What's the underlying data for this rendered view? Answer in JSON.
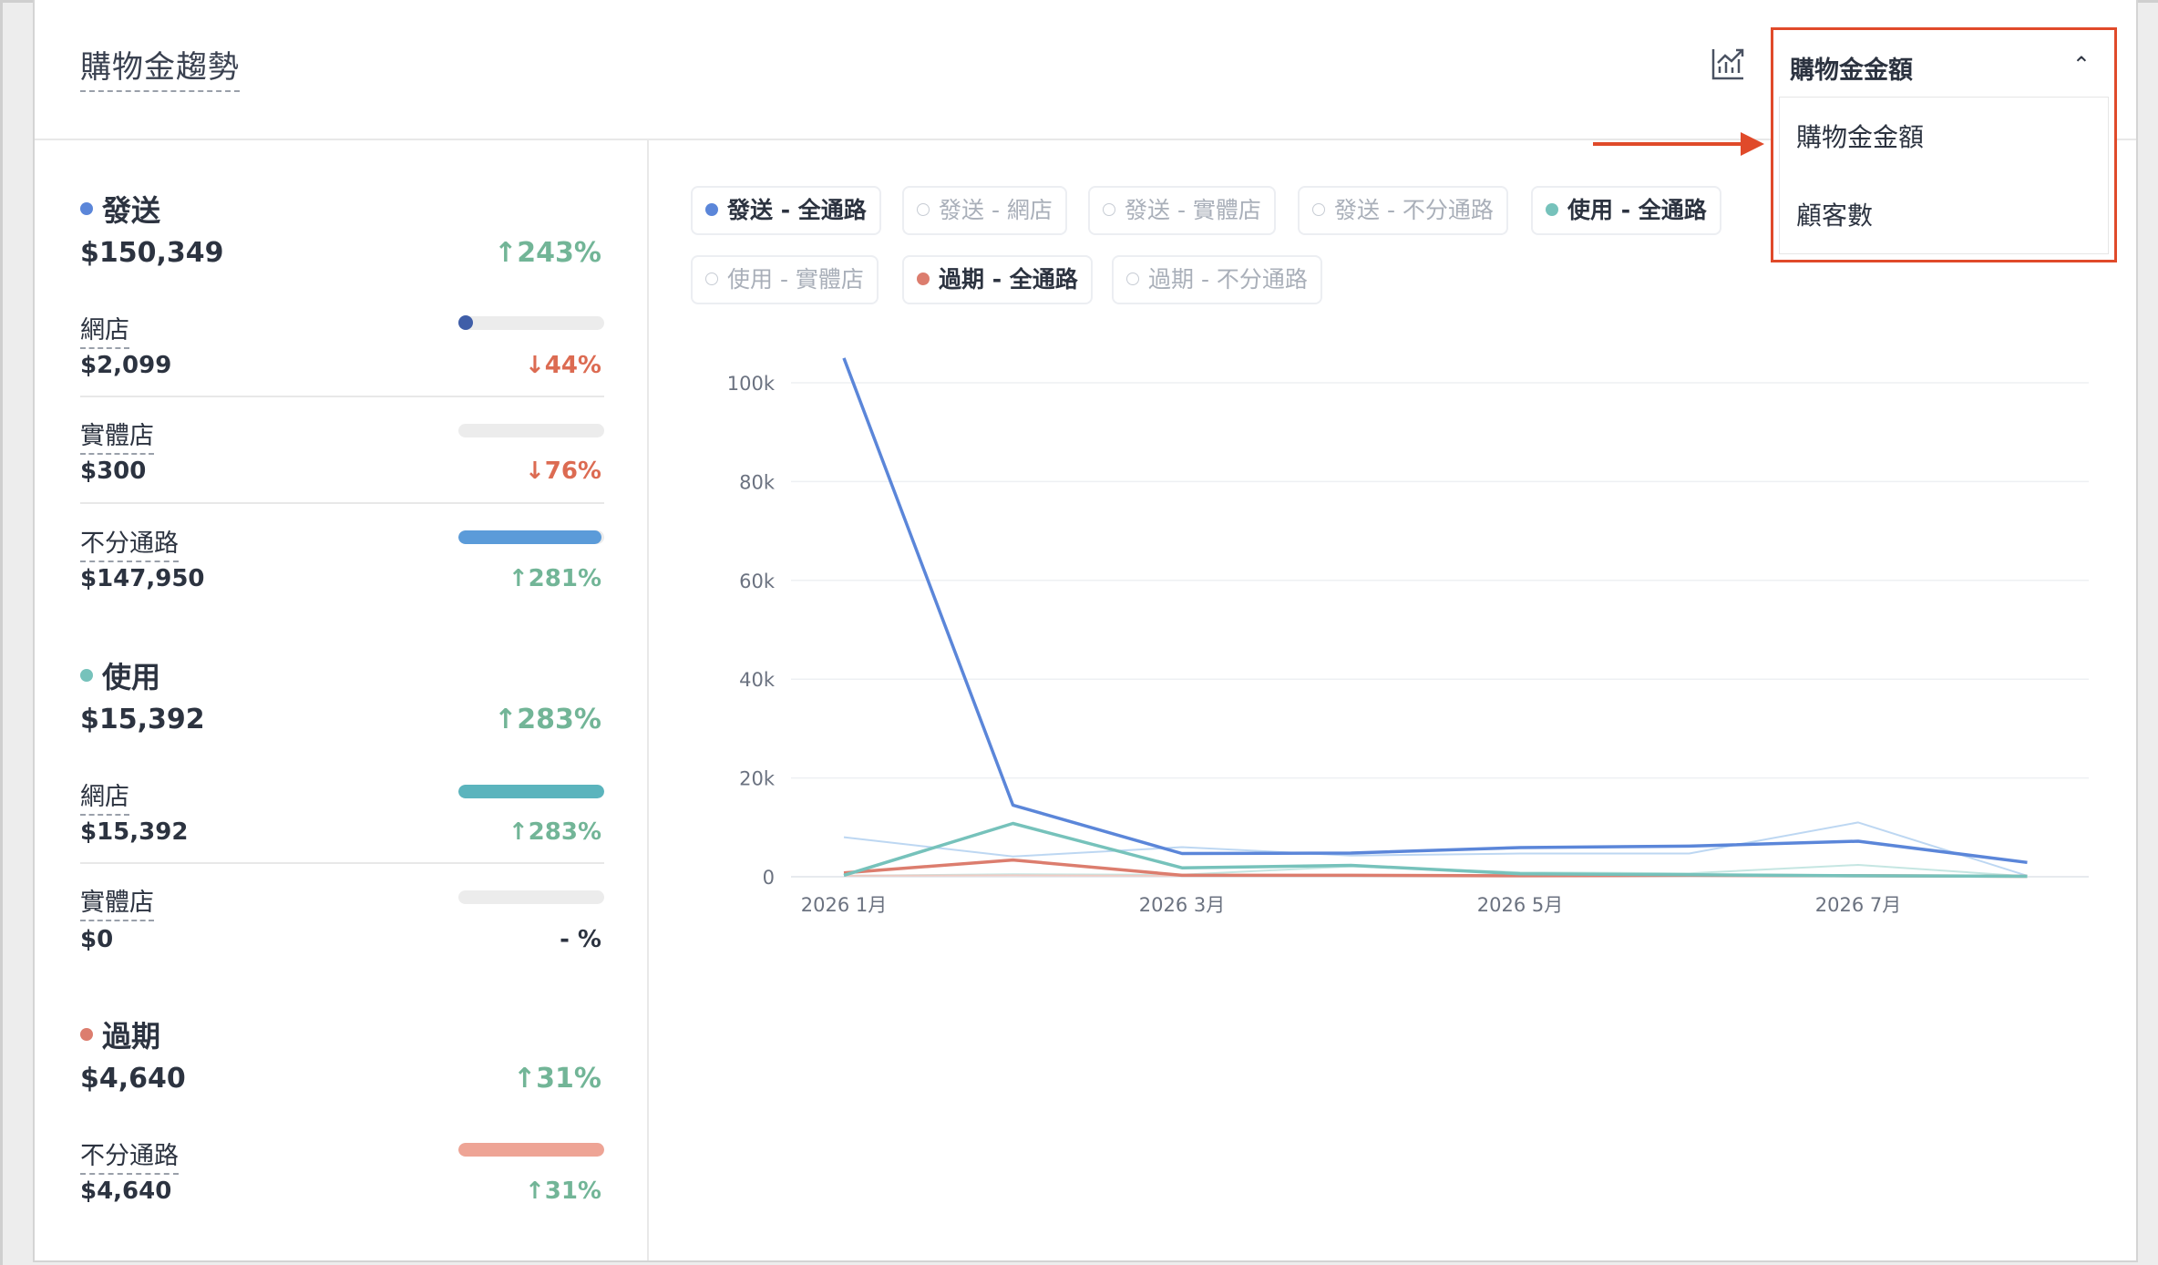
{
  "header": {
    "title": "購物金趨勢",
    "metric_select": {
      "selected": "購物金金額",
      "options": [
        "購物金金額",
        "顧客數"
      ]
    }
  },
  "colors": {
    "issue": "#5b86d9",
    "use": "#76c2bb",
    "expire": "#dc7d6e",
    "up": "#72b597",
    "down": "#dc6b52",
    "highlight": "#e04a2a"
  },
  "summary": {
    "groups": [
      {
        "name": "發送",
        "total": "$150,349",
        "change": "↑243%",
        "trend": "up",
        "color": "#5b86d9",
        "channels": [
          {
            "name": "網店",
            "value": "$2,099",
            "change": "↓44%",
            "trend": "down",
            "share": 0.014,
            "color": "#3f5ea8"
          },
          {
            "name": "實體店",
            "value": "$300",
            "change": "↓76%",
            "trend": "down",
            "share": 0.002,
            "color": "#5b86d9"
          },
          {
            "name": "不分通路",
            "value": "$147,950",
            "change": "↑281%",
            "trend": "up",
            "share": 0.984,
            "color": "#5b9bd9"
          }
        ]
      },
      {
        "name": "使用",
        "total": "$15,392",
        "change": "↑283%",
        "trend": "up",
        "color": "#76c2bb",
        "channels": [
          {
            "name": "網店",
            "value": "$15,392",
            "change": "↑283%",
            "trend": "up",
            "share": 1.0,
            "color": "#5bb4bd"
          },
          {
            "name": "實體店",
            "value": "$0",
            "change": "- %",
            "trend": "neutral",
            "share": 0,
            "color": "#5bb4bd"
          }
        ]
      },
      {
        "name": "過期",
        "total": "$4,640",
        "change": "↑31%",
        "trend": "up",
        "color": "#dc7d6e",
        "channels": [
          {
            "name": "不分通路",
            "value": "$4,640",
            "change": "↑31%",
            "trend": "up",
            "share": 1.0,
            "color": "#eea495"
          }
        ]
      }
    ]
  },
  "legend": [
    {
      "label": "發送 - 全通路",
      "active": true,
      "color": "#5b86d9"
    },
    {
      "label": "發送 - 網店",
      "active": false,
      "color": "#c7ccd4"
    },
    {
      "label": "發送 - 實體店",
      "active": false,
      "color": "#c7ccd4"
    },
    {
      "label": "發送 - 不分通路",
      "active": false,
      "color": "#c7ccd4"
    },
    {
      "label": "使用 - 全通路",
      "active": true,
      "color": "#76c2bb"
    },
    {
      "label": "使用 - 實體店",
      "active": false,
      "color": "#c7ccd4"
    },
    {
      "label": "過期 - 全通路",
      "active": true,
      "color": "#dc7d6e"
    },
    {
      "label": "過期 - 不分通路",
      "active": false,
      "color": "#c7ccd4"
    }
  ],
  "chart_data": {
    "type": "line",
    "x_categories": [
      "2026 1月",
      "2026 2月",
      "2026 3月",
      "2026 4月",
      "2026 5月",
      "2026 6月",
      "2026 7月",
      "2026 8月"
    ],
    "x_tick_labels": [
      "2026 1月",
      "2026 3月",
      "2026 5月",
      "2026 7月"
    ],
    "y_ticks": [
      0,
      20000,
      40000,
      60000,
      80000,
      100000
    ],
    "y_tick_labels": [
      "0",
      "20k",
      "40k",
      "60k",
      "80k",
      "100k"
    ],
    "ylim": [
      0,
      105000
    ],
    "grid": true,
    "series": [
      {
        "name": "發送 - 全通路",
        "color": "#5b86d9",
        "width": 3.5,
        "opacity": 1,
        "values": [
          105000,
          14500,
          4700,
          4800,
          5900,
          6200,
          7200,
          2900
        ]
      },
      {
        "name": "使用 - 全通路",
        "color": "#76c2bb",
        "width": 3.5,
        "opacity": 1,
        "values": [
          300,
          10800,
          1800,
          2300,
          600,
          400,
          200,
          100
        ]
      },
      {
        "name": "過期 - 全通路",
        "color": "#dc7d6e",
        "width": 3.5,
        "opacity": 1,
        "values": [
          800,
          3400,
          300,
          300,
          200,
          300,
          200,
          100
        ]
      },
      {
        "values": [
          8000,
          4100,
          6000,
          4300,
          4700,
          4700,
          11000,
          200
        ],
        "color": "#b6d3f1",
        "width": 2,
        "opacity": 0.9
      },
      {
        "values": [
          200,
          500,
          400,
          2100,
          900,
          700,
          2400,
          100
        ],
        "color": "#bfe3df",
        "width": 2,
        "opacity": 0.9
      },
      {
        "values": [
          200,
          300,
          200,
          200,
          300,
          200,
          200,
          100
        ],
        "color": "#f1c8c0",
        "width": 2,
        "opacity": 0.9
      }
    ]
  }
}
